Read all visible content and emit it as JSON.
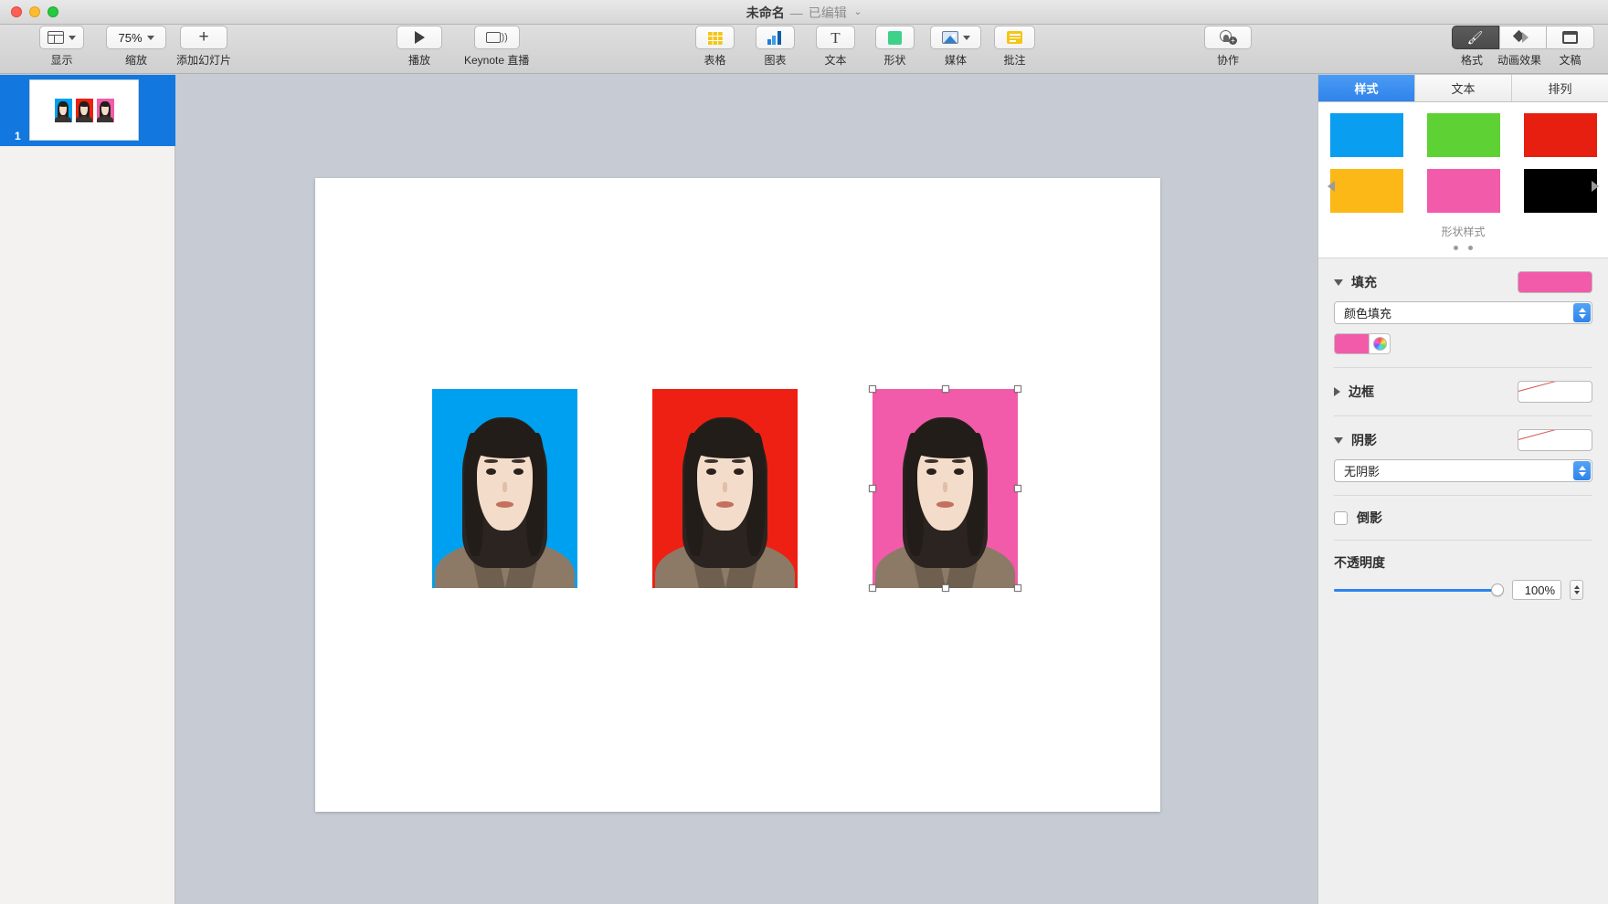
{
  "window": {
    "title": "未命名",
    "separator": "—",
    "edited_status": "已编辑",
    "title_chevron": "⌄"
  },
  "toolbar": {
    "items": [
      {
        "label": "显示",
        "icon": "display-layout-icon",
        "has_chevron": true
      },
      {
        "label": "缩放",
        "icon": "zoom-level-icon",
        "value": "75%",
        "has_chevron": true
      },
      {
        "label": "添加幻灯片",
        "icon": "plus-icon",
        "has_chevron": false
      },
      {
        "label": "播放",
        "icon": "play-icon",
        "has_chevron": false
      },
      {
        "label": "Keynote 直播",
        "icon": "live-broadcast-icon",
        "has_chevron": false
      },
      {
        "label": "表格",
        "icon": "table-icon",
        "has_chevron": false
      },
      {
        "label": "图表",
        "icon": "chart-icon",
        "has_chevron": false
      },
      {
        "label": "文本",
        "icon": "text-icon",
        "has_chevron": false
      },
      {
        "label": "形状",
        "icon": "shape-icon",
        "has_chevron": false
      },
      {
        "label": "媒体",
        "icon": "media-icon",
        "has_chevron": true
      },
      {
        "label": "批注",
        "icon": "comment-icon",
        "has_chevron": false
      },
      {
        "label": "协作",
        "icon": "collaborate-icon",
        "has_chevron": false
      }
    ],
    "right_group": [
      {
        "label": "格式",
        "icon": "format-brush-icon",
        "active": true
      },
      {
        "label": "动画效果",
        "icon": "animate-icon",
        "active": false
      },
      {
        "label": "文稿",
        "icon": "document-icon",
        "active": false
      }
    ]
  },
  "navigator": {
    "slides": [
      {
        "number": "1",
        "selected": true
      }
    ]
  },
  "canvas": {
    "photos": [
      {
        "name": "photo-blue",
        "bg_color": "#00A0F0",
        "selected": false
      },
      {
        "name": "photo-red",
        "bg_color": "#EE2013",
        "selected": false
      },
      {
        "name": "photo-pink",
        "bg_color": "#F25BAA",
        "selected": true
      }
    ]
  },
  "inspector": {
    "tabs": [
      {
        "label": "样式",
        "active": true
      },
      {
        "label": "文本",
        "active": false
      },
      {
        "label": "排列",
        "active": false
      }
    ],
    "shape_styles": {
      "caption": "形状样式",
      "swatches": [
        "#0A9EF0",
        "#5ED135",
        "#E61F10",
        "#FBB816",
        "#F25BAA",
        "#000000"
      ],
      "page_dots": 2,
      "active_dot": 0
    },
    "fill": {
      "title": "填充",
      "expanded": true,
      "preview_color": "#F25BAA",
      "select_value": "颜色填充",
      "color_value": "#F25BAA"
    },
    "border": {
      "title": "边框",
      "expanded": false,
      "preview": "none"
    },
    "shadow": {
      "title": "阴影",
      "expanded": true,
      "preview": "none",
      "select_value": "无阴影"
    },
    "reflection": {
      "label": "倒影",
      "checked": false
    },
    "opacity": {
      "label": "不透明度",
      "value": "100%",
      "percent": 100
    }
  },
  "colors": {
    "accent_blue": "#2d84ec",
    "selection_blue": "#1278e0",
    "canvas_bg": "#c6cbd4"
  }
}
